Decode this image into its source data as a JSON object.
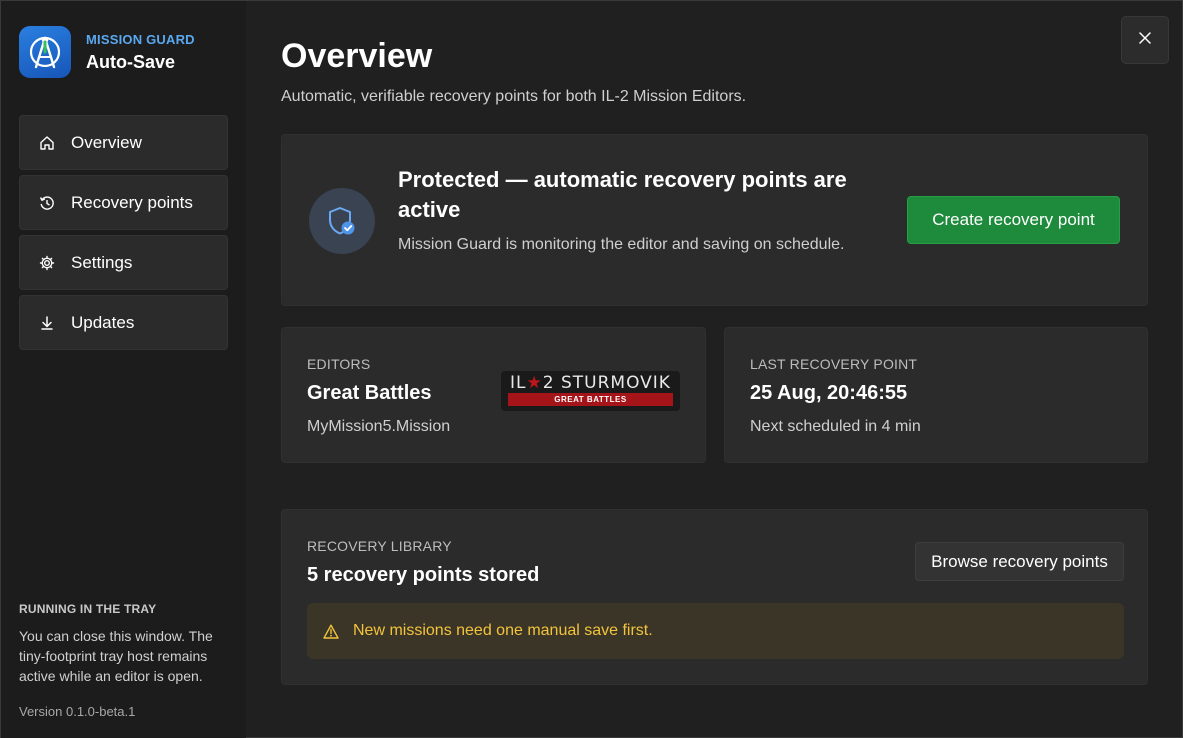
{
  "brand": {
    "small": "MISSION GUARD",
    "big": "Auto-Save",
    "logo_icon": "compass-logo-icon",
    "accent": "#5aa8f0"
  },
  "sidebar": {
    "items": [
      {
        "label": "Overview",
        "icon": "home-icon"
      },
      {
        "label": "Recovery points",
        "icon": "history-icon"
      },
      {
        "label": "Settings",
        "icon": "gear-icon"
      },
      {
        "label": "Updates",
        "icon": "download-icon"
      }
    ],
    "tray_title": "RUNNING IN THE TRAY",
    "tray_desc": "You can close this window. The tiny-footprint tray host remains active while an editor is open.",
    "version": "Version 0.1.0-beta.1"
  },
  "header": {
    "title": "Overview",
    "subtitle": "Automatic, verifiable recovery points for both IL-2 Mission Editors.",
    "close_icon": "close-icon"
  },
  "status": {
    "title": "Protected — automatic recovery points are active",
    "description": "Mission Guard is monitoring the editor and saving on schedule.",
    "button": "Create recovery point",
    "icon": "shield-check-icon",
    "button_color": "#1e8a3c"
  },
  "editors": {
    "caption": "EDITORS",
    "value": "Great Battles",
    "sub": "MyMission5.Mission",
    "logo_top_left": "IL",
    "logo_top_right": "2 STURMOVIK",
    "logo_bottom": "GREAT BATTLES"
  },
  "last_recovery": {
    "caption": "LAST RECOVERY POINT",
    "value": "25 Aug, 20:46:55",
    "sub": "Next scheduled in 4 min"
  },
  "library": {
    "caption": "RECOVERY LIBRARY",
    "value": "5 recovery points stored",
    "button": "Browse recovery points",
    "warning": "New missions need one manual save first.",
    "warning_icon": "warning-icon",
    "warning_color": "#f3c33d"
  }
}
